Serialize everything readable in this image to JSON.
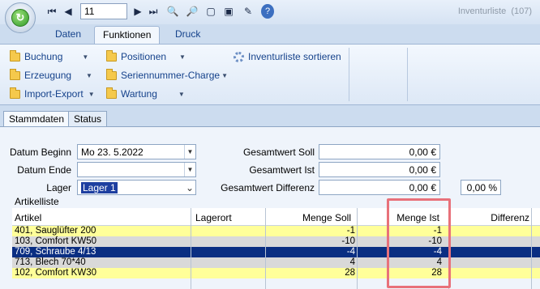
{
  "titlebar": {
    "record_number": "11",
    "app_title": "Inventurliste",
    "app_count": "(107)"
  },
  "ribbon_tabs": [
    "Daten",
    "Funktionen",
    "Druck"
  ],
  "ribbon": {
    "col1": [
      "Buchung",
      "Erzeugung",
      "Import-Export"
    ],
    "col2": [
      "Positionen",
      "Seriennummer-Charge",
      "Wartung"
    ],
    "sort_label": "Inventurliste sortieren"
  },
  "panel_tabs": [
    "Stammdaten",
    "Status"
  ],
  "form": {
    "datum_beginn_label": "Datum Beginn",
    "datum_beginn_value": "Mo 23.  5.2022",
    "datum_ende_label": "Datum Ende",
    "datum_ende_value": "",
    "lager_label": "Lager",
    "lager_value": "Lager 1",
    "gesamtwert_soll_label": "Gesamtwert Soll",
    "gesamtwert_soll_value": "0,00 €",
    "gesamtwert_ist_label": "Gesamtwert Ist",
    "gesamtwert_ist_value": "0,00 €",
    "gesamtwert_differenz_label": "Gesamtwert Differenz",
    "gesamtwert_differenz_value": "0,00 €",
    "percent_value": "0,00 %"
  },
  "artikelliste": {
    "label": "Artikelliste",
    "columns": [
      "Artikel",
      "Lagerort",
      "Menge Soll",
      "Menge Ist",
      "Differenz"
    ],
    "rows": [
      {
        "artikel": "401, Sauglüfter 200",
        "lagerort": "",
        "soll": "-1",
        "ist": "-1",
        "differenz": ""
      },
      {
        "artikel": "103, Comfort KW50",
        "lagerort": "",
        "soll": "-10",
        "ist": "-10",
        "differenz": ""
      },
      {
        "artikel": "709, Schraube 4/13",
        "lagerort": "",
        "soll": "-4",
        "ist": "-4",
        "differenz": ""
      },
      {
        "artikel": "713, Blech 70*40",
        "lagerort": "",
        "soll": "4",
        "ist": "4",
        "differenz": ""
      },
      {
        "artikel": "102, Comfort KW30",
        "lagerort": "",
        "soll": "28",
        "ist": "28",
        "differenz": ""
      }
    ]
  },
  "colors": {
    "selected_row": "#0a2e82",
    "yellow_row": "#ffff99",
    "gray_row": "#d9d9d9",
    "highlight": "#e8717a"
  }
}
